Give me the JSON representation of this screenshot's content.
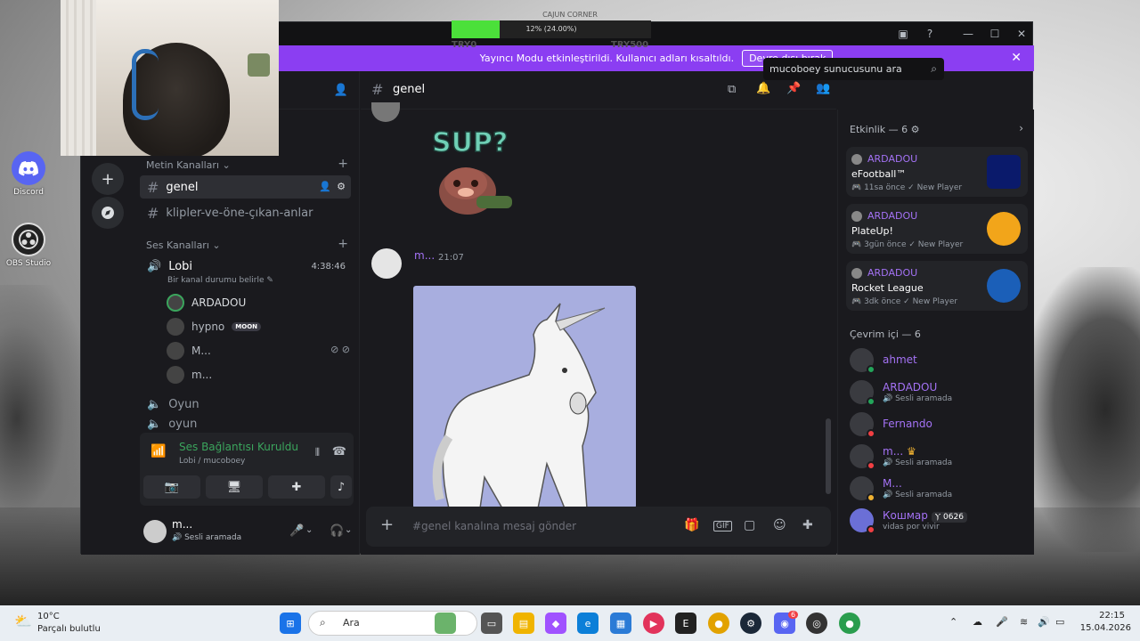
{
  "obs": {
    "title": "CAJUN CORNER",
    "progress_text": "12% (24.00%)",
    "progress": 0.24,
    "left_label": "TRY0",
    "right_label": "TRY500"
  },
  "desktop": {
    "icons": [
      {
        "label": "Discord"
      },
      {
        "label": "OBS Studio"
      }
    ]
  },
  "streamer_mode": {
    "message": "Yayıncı Modu etkinleştirildi. Kullanıcı adları kısaltıldı.",
    "button": "Devre dışı bırak"
  },
  "sidebar": {
    "text_category": "Metin Kanalları",
    "channels": [
      {
        "name": "genel"
      },
      {
        "name": "klipler-ve-öne-çıkan-anlar"
      }
    ],
    "voice_category": "Ses Kanalları",
    "voice_channel": {
      "name": "Lobi",
      "time": "4:38:46",
      "status": "Bir kanal durumu belirle"
    },
    "voice_users": [
      {
        "name": "ARDADOU"
      },
      {
        "name": "hypno",
        "badge": "MOON"
      },
      {
        "name": "M..."
      },
      {
        "name": "m..."
      }
    ],
    "other_voice": [
      {
        "name": "Oyun"
      },
      {
        "name": "oyun"
      }
    ]
  },
  "voice_panel": {
    "status": "Ses Bağlantısı Kuruldu",
    "sub": "Lobi / mucoboey"
  },
  "user": {
    "name": "m...",
    "status": "Sesli aramada"
  },
  "chat": {
    "channel": "genel",
    "sticker_text": "SUP?",
    "message_author": "m...",
    "message_time": "21:07",
    "input_placeholder": "#genel kanalına mesaj gönder"
  },
  "search": {
    "placeholder": "mucoboey sunucusunu ara"
  },
  "members": {
    "activity_header": "Etkinlik — 6",
    "activities": [
      {
        "user": "ARDADOU",
        "game": "eFootball™",
        "time": "11sa önce",
        "tag": "New Player",
        "thumb_color": "#0a1a6b"
      },
      {
        "user": "ARDADOU",
        "game": "PlateUp!",
        "time": "3gün önce",
        "tag": "New Player",
        "thumb_color": "#f2a51a"
      },
      {
        "user": "ARDADOU",
        "game": "Rocket League",
        "time": "3dk önce",
        "tag": "New Player",
        "thumb_color": "#1b5fb8"
      }
    ],
    "online_header": "Çevrim içi — 6",
    "online": [
      {
        "name": "ahmet",
        "sub": "",
        "color": "#a472f5",
        "status": "#23a55a"
      },
      {
        "name": "ARDADOU",
        "sub": "Sesli aramada",
        "color": "#a472f5",
        "status": "#23a55a"
      },
      {
        "name": "Fernando",
        "sub": "",
        "color": "#a472f5",
        "status": "#f23f43"
      },
      {
        "name": "m...",
        "sub": "Sesli aramada",
        "color": "#a472f5",
        "status": "#f23f43"
      },
      {
        "name": "M...",
        "sub": "Sesli aramada",
        "color": "#a472f5",
        "status": "#f0b232"
      },
      {
        "name": "Кошмар",
        "sub": "vidas por vivir",
        "color": "#a472f5",
        "status": "#f23f43",
        "badge": "0626"
      }
    ]
  },
  "taskbar": {
    "weather_temp": "10°C",
    "weather_desc": "Parçalı bulutlu",
    "search": "Ara",
    "time": "22:15",
    "date": "15.04.2026",
    "discord_badge": "6"
  }
}
